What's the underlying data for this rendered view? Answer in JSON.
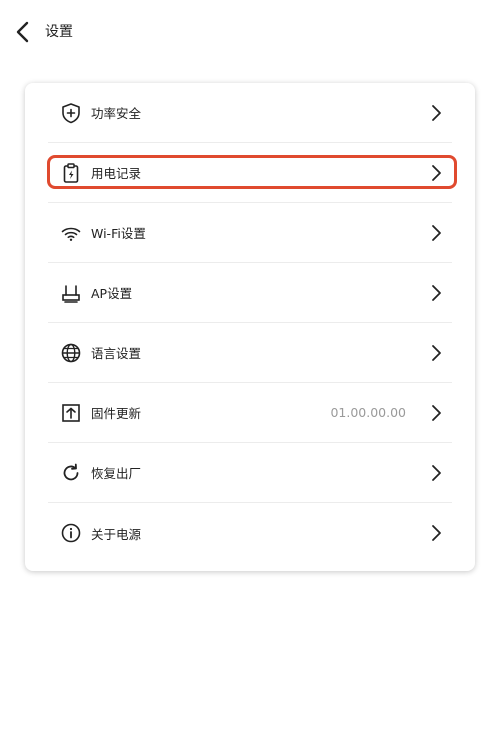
{
  "header": {
    "title": "设置",
    "back_icon": "chevron-left-icon"
  },
  "settings": {
    "items": [
      {
        "label": "功率安全",
        "icon": "shield-plus-icon",
        "value": ""
      },
      {
        "label": "用电记录",
        "icon": "clipboard-bolt-icon",
        "value": ""
      },
      {
        "label": "Wi-Fi设置",
        "icon": "wifi-icon",
        "value": ""
      },
      {
        "label": "AP设置",
        "icon": "router-icon",
        "value": ""
      },
      {
        "label": "语言设置",
        "icon": "globe-icon",
        "value": ""
      },
      {
        "label": "固件更新",
        "icon": "upload-box-icon",
        "value": "01.00.00.00"
      },
      {
        "label": "恢复出厂",
        "icon": "reset-icon",
        "value": ""
      },
      {
        "label": "关于电源",
        "icon": "info-icon",
        "value": ""
      }
    ],
    "highlighted_item": "用电记录"
  },
  "colors": {
    "highlight": "#e04a2f",
    "value_text": "#9a9a9a",
    "text": "#222222"
  }
}
